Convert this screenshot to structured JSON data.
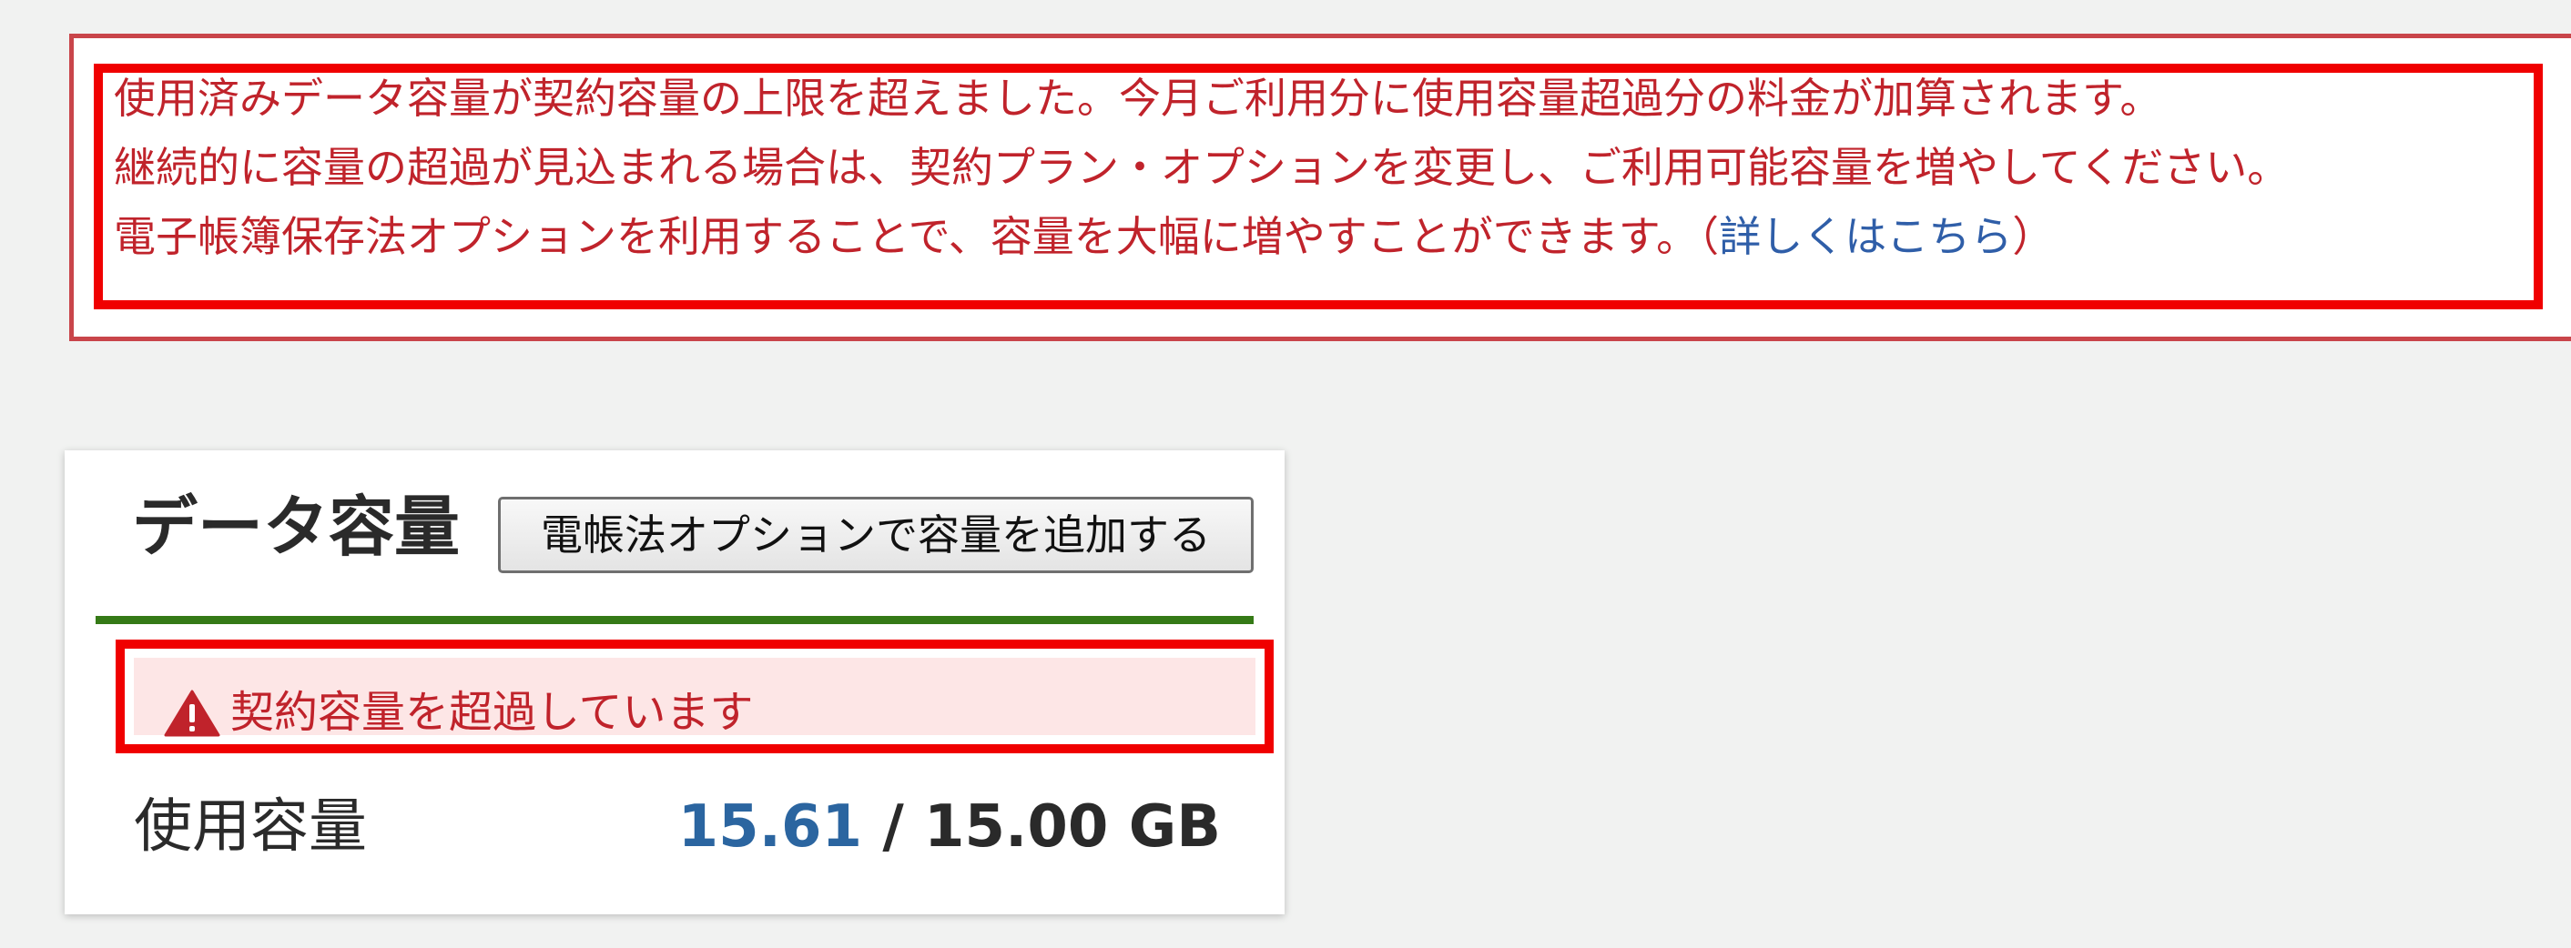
{
  "notice": {
    "lines": [
      "使用済みデータ容量が契約容量の上限を超えました。今月ご利用分に使用容量超過分の料金が加算されます。",
      "継続的に容量の超過が見込まれる場合は、契約プラン・オプションを変更し、ご利用可能容量を増やしてください。",
      "電子帳簿保存法オプションを利用することで、容量を大幅に増やすことができます。（"
    ],
    "link_text": "詳しくはこちら",
    "link_suffix": "）",
    "text_color": "#c0232b",
    "link_color": "#2f5ea8",
    "border_color": "#c9454a",
    "highlight_color": "#f00000"
  },
  "card": {
    "title": "データ容量",
    "add_button_label": "電帳法オプションで容量を追加する",
    "alert": {
      "icon": "warning-icon",
      "text": "契約容量を超過しています",
      "background": "#fde6e6"
    },
    "usage": {
      "label": "使用容量",
      "used": "15.61",
      "separator": " / ",
      "total": "15.00 GB",
      "used_color": "#2b65a0"
    },
    "rule_color": "#357a16"
  }
}
